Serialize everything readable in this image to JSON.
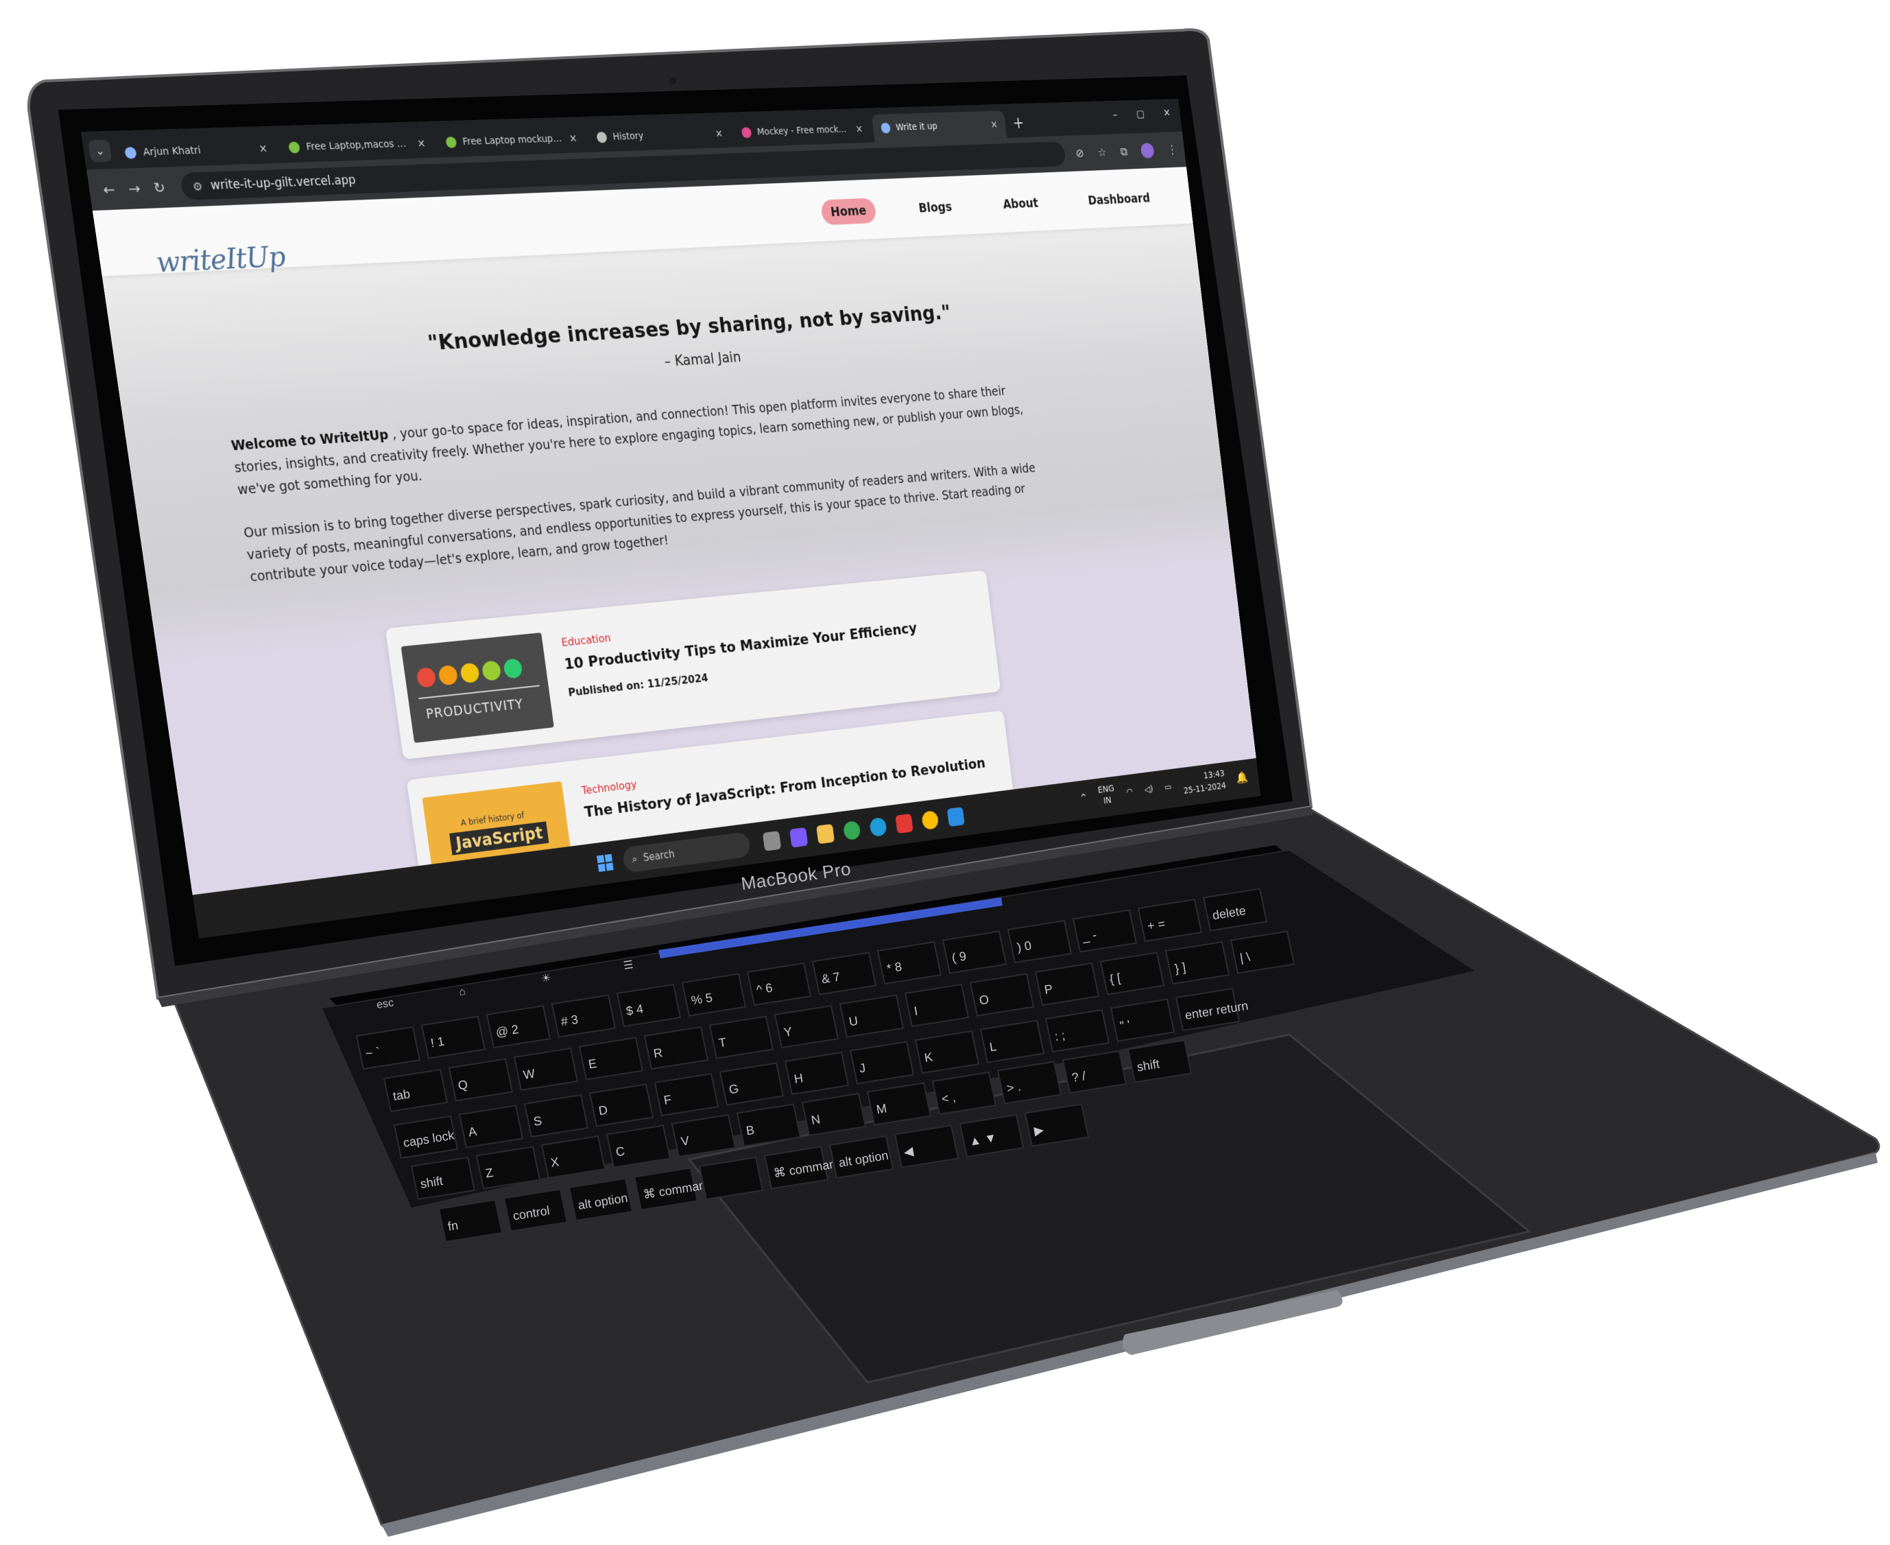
{
  "device": {
    "brand_label": "MacBook Pro"
  },
  "browser": {
    "tabs": [
      {
        "title": "Arjun Khatri",
        "close": "×",
        "active": false,
        "favicon_color": "#8ab4f8"
      },
      {
        "title": "Free Laptop,macos mockup",
        "close": "×",
        "active": false,
        "favicon_color": "#7bc043"
      },
      {
        "title": "Free Laptop mockups | Mo",
        "close": "×",
        "active": false,
        "favicon_color": "#7bc043"
      },
      {
        "title": "History",
        "close": "×",
        "active": false,
        "favicon_color": "#bdbdbd"
      },
      {
        "title": "Mockey - Free mockup ge",
        "close": "×",
        "active": false,
        "favicon_color": "#e24b8f"
      },
      {
        "title": "Write it up",
        "close": "×",
        "active": true,
        "favicon_color": "#8ab4f8"
      }
    ],
    "new_tab": "+",
    "window_controls": {
      "minimize": "–",
      "maximize": "▢",
      "close": "✕"
    },
    "nav": {
      "back": "←",
      "forward": "→",
      "reload": "↻"
    },
    "address": "write-it-up-gilt.vercel.app",
    "site_info_icon": "⚙",
    "toolbar_icons": {
      "eye_off": "⊘",
      "star": "☆",
      "extensions": "⧉",
      "menu": "⋮"
    }
  },
  "site": {
    "logo": "writeItUp",
    "nav": [
      {
        "label": "Home",
        "active": true
      },
      {
        "label": "Blogs",
        "active": false
      },
      {
        "label": "About",
        "active": false
      },
      {
        "label": "Dashboard",
        "active": false
      }
    ],
    "quote": "\"Knowledge increases by sharing, not by saving.\"",
    "author": "– Kamal Jain",
    "intro_brand": "Welcome to WriteItUp",
    "intro_p1_rest": ", your go-to space for ideas, inspiration, and connection! This open platform invites everyone to share their stories, insights, and creativity freely. Whether you're here to explore engaging topics, learn something new, or publish your own blogs, we've got something for you.",
    "intro_p2": "Our mission is to bring together diverse perspectives, spark curiosity, and build a vibrant community of readers and writers. With a wide variety of posts, meaningful conversations, and endless opportunities to express yourself, this is your space to thrive. Start reading or contribute your voice today—let's explore, learn, and grow together!",
    "posts": [
      {
        "category": "Education",
        "title": "10 Productivity Tips to Maximize Your Efficiency",
        "published": "Published on: 11/25/2024",
        "thumb_text": "PRODUCTIVITY"
      },
      {
        "category": "Technology",
        "title": "The History of JavaScript: From Inception to Revolution",
        "published": "",
        "thumb_small": "A brief history of",
        "thumb_text": "JavaScript"
      }
    ]
  },
  "taskbar": {
    "search_placeholder": "Search",
    "search_icon": "⌕",
    "tray_chevron": "^",
    "lang_top": "ENG",
    "lang_bottom": "IN",
    "wifi_icon": "◠",
    "volume_icon": "◁)",
    "battery_icon": "▭",
    "time": "13:43",
    "date": "25-11-2024",
    "bell_icon": "🔔"
  },
  "keyboard": {
    "touchbar_keys": [
      "esc",
      "⌂",
      "☀",
      "☰"
    ],
    "row_numbers": [
      [
        "~",
        "`"
      ],
      [
        "!",
        "1"
      ],
      [
        "@",
        "2"
      ],
      [
        "#",
        "3"
      ],
      [
        "$",
        "4"
      ],
      [
        "%",
        "5"
      ],
      [
        "^",
        "6"
      ],
      [
        "&",
        "7"
      ],
      [
        "*",
        "8"
      ],
      [
        "(",
        "9"
      ],
      [
        ")",
        "0"
      ],
      [
        "_",
        "-"
      ],
      [
        "+",
        "="
      ],
      [
        "delete",
        ""
      ]
    ],
    "row_q": [
      "tab",
      "Q",
      "W",
      "E",
      "R",
      "T",
      "Y",
      "U",
      "I",
      "O",
      "P",
      "{ [",
      "} ]",
      "| \\"
    ],
    "row_a": [
      "caps lock",
      "A",
      "S",
      "D",
      "F",
      "G",
      "H",
      "J",
      "K",
      "L",
      ": ;",
      "\" '",
      "enter return"
    ],
    "row_z": [
      "shift",
      "Z",
      "X",
      "C",
      "V",
      "B",
      "N",
      "M",
      "< ,",
      "> .",
      "? /",
      "shift"
    ],
    "row_bottom": [
      "fn",
      "control",
      "alt option",
      "⌘ command",
      "",
      "⌘ command",
      "alt option",
      "◀",
      "▲ ▼",
      "▶"
    ]
  },
  "colors": {
    "body": "#222224",
    "bezel": "#0a0a0a",
    "chrome_dark": "#202124",
    "chrome_toolbar": "#35363a",
    "accent_home": "#ef9aa2",
    "category_red": "#d8292f",
    "logo_blue": "#4f6f96"
  }
}
